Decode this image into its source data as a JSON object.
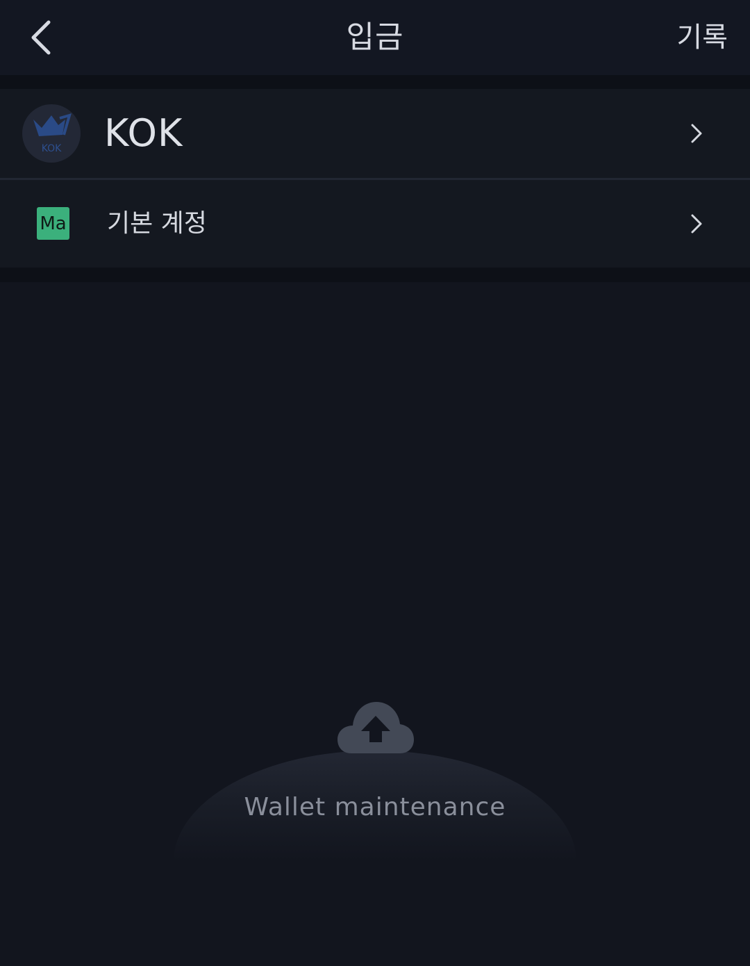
{
  "header": {
    "title": "입금",
    "history_label": "기록"
  },
  "coin": {
    "name": "KOK",
    "logo_text": "KOK"
  },
  "account": {
    "badge_text": "Ma",
    "label": "기본 계정",
    "badge_color": "#3bb07c"
  },
  "status": {
    "message": "Wallet maintenance"
  },
  "colors": {
    "background": "#12151e",
    "row_background": "#141820",
    "text_primary": "#d6d9e0",
    "text_muted": "#8a8f9b"
  }
}
